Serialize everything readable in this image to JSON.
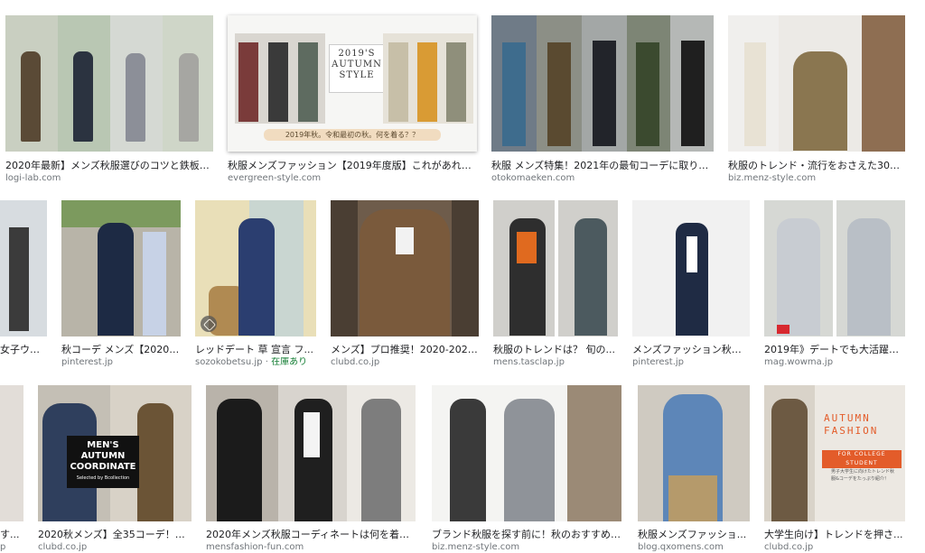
{
  "results": [
    {
      "caption": "2020年最新】メンズ秋服選びのコツと鉄板ア...",
      "source": "logi-lab.com"
    },
    {
      "caption": "秋服メンズファッション【2019年度版】これがあれば0...",
      "source": "evergreen-style.com",
      "overlay_title": "2019'S AUTUMN STYLE",
      "overlay_strip": "2019年秋。令和最初の秋。何を着る？？"
    },
    {
      "caption": "秋服 メンズ特集！2021年の最旬コーデに取り入...",
      "source": "otokomaeken.com"
    },
    {
      "caption": "秋服のトレンド・流行をおさえた30代4...",
      "source": "biz.menz-style.com"
    },
    {
      "caption": "女子ウケ...",
      "source": ""
    },
    {
      "caption": "秋コーデ メンズ【2020/...",
      "source": "pinterest.jp"
    },
    {
      "caption": "レッドデート 草 宣言 フ...",
      "source": "sozokobetsu.jp",
      "stock": "在庫あり"
    },
    {
      "caption": "メンズ】プロ推奨！2020-2021...",
      "source": "clubd.co.jp"
    },
    {
      "caption": "秋服のトレンドは？ 旬の...",
      "source": "mens.tasclap.jp"
    },
    {
      "caption": "メンズファッション秋服...",
      "source": "pinterest.jp"
    },
    {
      "caption": "2019年》デートでも大活躍！...",
      "source": "mag.wowma.jp"
    },
    {
      "caption": "す...",
      "source": "p"
    },
    {
      "caption": "2020秋メンズ】全35コーデ！オ...",
      "source": "clubd.co.jp",
      "overlay_title": "MEN'S AUTUMN COORDINATE",
      "overlay_sub": "Selected by Bcollection"
    },
    {
      "caption": "2020年メンズ秋服コーディネートは何を着る...",
      "source": "mensfashion-fun.com"
    },
    {
      "caption": "ブランド秋服を探す前に！秋のおすすめ秋...",
      "source": "biz.menz-style.com"
    },
    {
      "caption": "秋服メンズファッショ...",
      "source": "blog.qxomens.com"
    },
    {
      "caption": "大学生向け】トレンドを押さ...",
      "source": "clubd.co.jp",
      "overlay_title": "AUTUMN FASHION",
      "overlay_sub": "FOR COLLEGE STUDENT",
      "overlay_body": "男子大学生に向けたトレンド秋服&コーデをたっぷり紹介！"
    }
  ],
  "colors": {
    "caption": "#202124",
    "source": "#70757a",
    "stock": "#188038",
    "autumn": "#e35c2a"
  }
}
